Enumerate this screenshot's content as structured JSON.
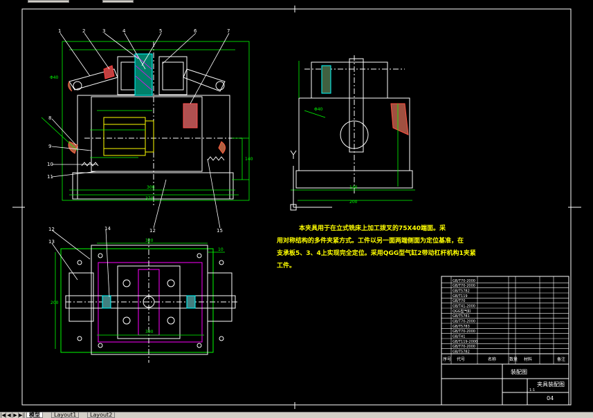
{
  "colors": {
    "bg": "#000000",
    "frame": "#ffffff",
    "green": "#00ff00",
    "yellow": "#ffff00",
    "magenta": "#ff00ff",
    "cyan": "#00ffff",
    "red": "#ff3030"
  },
  "view_front": {
    "callouts": [
      "1",
      "2",
      "3",
      "4",
      "5",
      "6",
      "7",
      "8",
      "9",
      "10",
      "11"
    ],
    "callout_bottom": [
      "12",
      "15"
    ],
    "dim_bottom_inner": "300",
    "dim_bottom_outer": "370",
    "dim_left_small": "Φ40",
    "dim_right": "140"
  },
  "view_side": {
    "dim_bottom_inner": "140",
    "dim_bottom_outer": "200",
    "dim_top": "Φ40",
    "axis_label": "Y"
  },
  "view_top": {
    "callouts": [
      "12",
      "13",
      "14"
    ],
    "dim_top": "320",
    "dim_left": "200",
    "dim_bottom": "300",
    "dim_right": "10"
  },
  "note": {
    "line1": "本夹具用于在立式铣床上加工拨叉的75X40端面。采",
    "line2": "用对称结构的多件夹紧方式。工件以另一面两端侧面为定位基准，在",
    "line3": "支承板5、3、4上实现完全定位。采用QGG型气缸2带动杠杆机构1夹紧",
    "line4": "工件。"
  },
  "title_block": {
    "drawing_name": "装配图",
    "title": "夹具装配图",
    "sheet": "04",
    "scale": "1:1",
    "header_labels": [
      "序号",
      "代号",
      "名称",
      "数量",
      "材料",
      "备注"
    ],
    "part_rows": [
      "GB/T70-2000",
      "GB/T70-2000",
      "GB/T5782",
      "GB/T119",
      "GB/T70",
      "GB/T41-2000",
      "QGG型气缸",
      "GB/T5781",
      "GB/T70-2000",
      "GB/T5783",
      "GB/T70-2000",
      "GB/T41",
      "GB/T119-2000",
      "GB/T70-2000",
      "GB/T5782"
    ]
  },
  "tabs": {
    "items": [
      "模型",
      "Layout1",
      "Layout2"
    ],
    "active": 0
  }
}
